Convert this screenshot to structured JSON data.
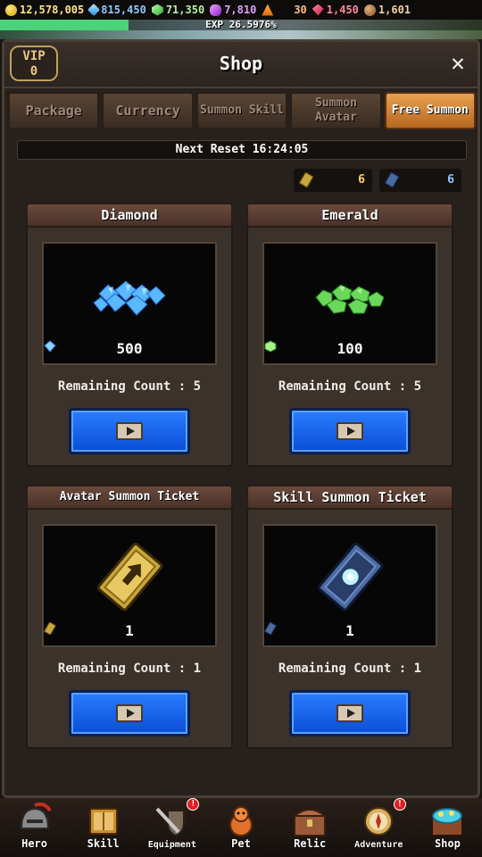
{
  "resources": {
    "gold": "12,578,005",
    "diamond": "815,450",
    "emerald": "71,350",
    "purple": "7,810",
    "orange": "30",
    "ruby": "1,450",
    "coin2": "1,601"
  },
  "exp": {
    "label": "EXP 26.5976%",
    "fraction": 0.265976
  },
  "header": {
    "title": "Shop",
    "vip_label": "VIP",
    "vip_level": "0",
    "close_symbol": "✕"
  },
  "tabs": [
    {
      "label": "Package"
    },
    {
      "label": "Currency"
    },
    {
      "label": "Summon Skill"
    },
    {
      "label": "Summon Avatar"
    },
    {
      "label": "Free Summon"
    }
  ],
  "next_reset": "Next Reset 16:24:05",
  "tickets": {
    "avatar_count": "6",
    "skill_count": "6"
  },
  "cards": [
    {
      "title": "Diamond",
      "amount": "500",
      "remaining": "Remaining Count : 5"
    },
    {
      "title": "Emerald",
      "amount": "100",
      "remaining": "Remaining Count : 5"
    },
    {
      "title": "Avatar Summon Ticket",
      "amount": "1",
      "remaining": "Remaining Count : 1"
    },
    {
      "title": "Skill Summon Ticket",
      "amount": "1",
      "remaining": "Remaining Count : 1"
    }
  ],
  "nav": [
    {
      "label": "Hero",
      "icon": "helmet-icon"
    },
    {
      "label": "Skill",
      "icon": "book-icon"
    },
    {
      "label": "Equipment",
      "icon": "sword-shield-icon",
      "badge": "!"
    },
    {
      "label": "Pet",
      "icon": "dragon-icon"
    },
    {
      "label": "Relic",
      "icon": "chest-icon"
    },
    {
      "label": "Adventure",
      "icon": "compass-icon",
      "badge": "!"
    },
    {
      "label": "Shop",
      "icon": "treasure-icon"
    }
  ],
  "colors": {
    "accent_tab": "#e8a050",
    "button_blue": "#1a66f0"
  }
}
